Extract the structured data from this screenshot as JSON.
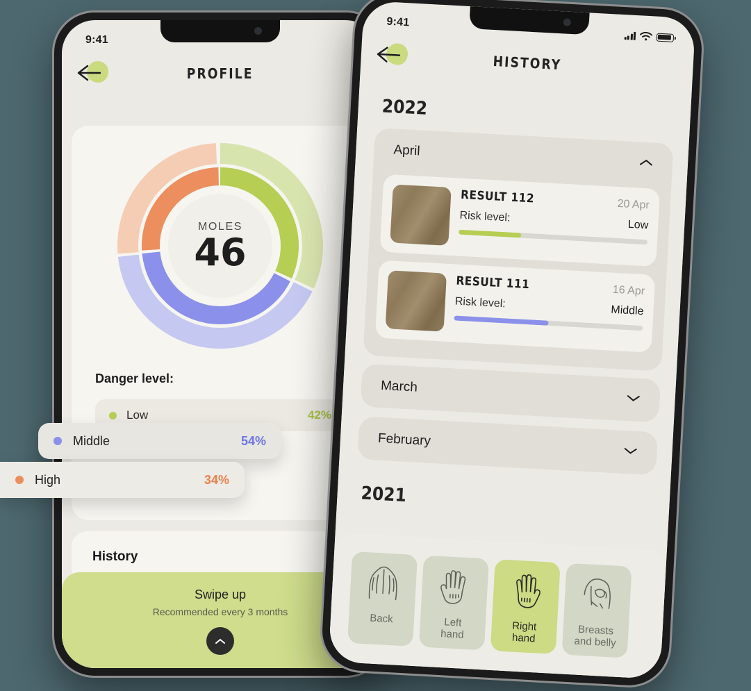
{
  "background_color": "#4d686f",
  "left_phone": {
    "status_bar": {
      "time": "9:41"
    },
    "header": {
      "title": "PROFILE",
      "back_icon": "arrow-left-icon"
    },
    "donut": {
      "center_label": "MOLES",
      "center_value": "46"
    },
    "danger_level": {
      "heading": "Danger level:",
      "rows": [
        {
          "label": "Low",
          "percent": "42%",
          "color": "#b5ce53"
        },
        {
          "label": "Middle",
          "percent": "54%",
          "color": "#8b90ea"
        },
        {
          "label": "High",
          "percent": "34%",
          "color": "#ec8e5e"
        }
      ]
    },
    "history_card": {
      "label": "History",
      "chevron_icon": "chevron-right-icon"
    },
    "swipe_card": {
      "title": "Swipe up",
      "subtitle": "Recommended every 3 months",
      "fab_icon": "chevron-up-icon",
      "color": "#cfdd8c"
    }
  },
  "right_phone": {
    "status_bar": {
      "time": "9:41",
      "signal_icon": "cellular-icon",
      "wifi_icon": "wifi-icon",
      "battery_icon": "battery-icon"
    },
    "header": {
      "title": "HISTORY",
      "back_icon": "arrow-left-icon"
    },
    "years": [
      {
        "label": "2022"
      },
      {
        "label": "2021"
      }
    ],
    "months": [
      {
        "label": "April",
        "expanded": true,
        "chevron_icon": "chevron-up-icon"
      },
      {
        "label": "March",
        "expanded": false,
        "chevron_icon": "chevron-down-icon"
      },
      {
        "label": "February",
        "expanded": false,
        "chevron_icon": "chevron-down-icon"
      }
    ],
    "results": [
      {
        "name": "RESULT 112",
        "date": "20 Apr",
        "risk_label": "Risk level:",
        "risk_value": "Low",
        "risk_percent": 33,
        "risk_color": "#b5ce53"
      },
      {
        "name": "RESULT 111",
        "date": "16 Apr",
        "risk_label": "Risk level:",
        "risk_value": "Middle",
        "risk_percent": 50,
        "risk_color": "#8b90ea"
      }
    ],
    "body_tabs": [
      {
        "label": "Back",
        "icon": "back-body-icon",
        "active": false
      },
      {
        "label": "Left\nhand",
        "icon": "left-hand-icon",
        "active": false
      },
      {
        "label": "Right\nhand",
        "icon": "right-hand-icon",
        "active": true
      },
      {
        "label": "Breasts\nand belly",
        "icon": "torso-icon",
        "active": false
      }
    ]
  },
  "chart_data": {
    "type": "pie",
    "title": "Moles by danger level",
    "categories": [
      "Low",
      "Middle",
      "High"
    ],
    "values": [
      42,
      54,
      34
    ],
    "normalized_percent": [
      32.3,
      41.5,
      26.2
    ],
    "colors_inner": [
      "#b5ce53",
      "#8b90ea",
      "#ec8e5e"
    ],
    "colors_outer": [
      "#d8e4ae",
      "#c5c8f0",
      "#f5cdb4"
    ],
    "center_label": "MOLES",
    "center_value": 46,
    "legend_position": "below",
    "rings": 2
  }
}
